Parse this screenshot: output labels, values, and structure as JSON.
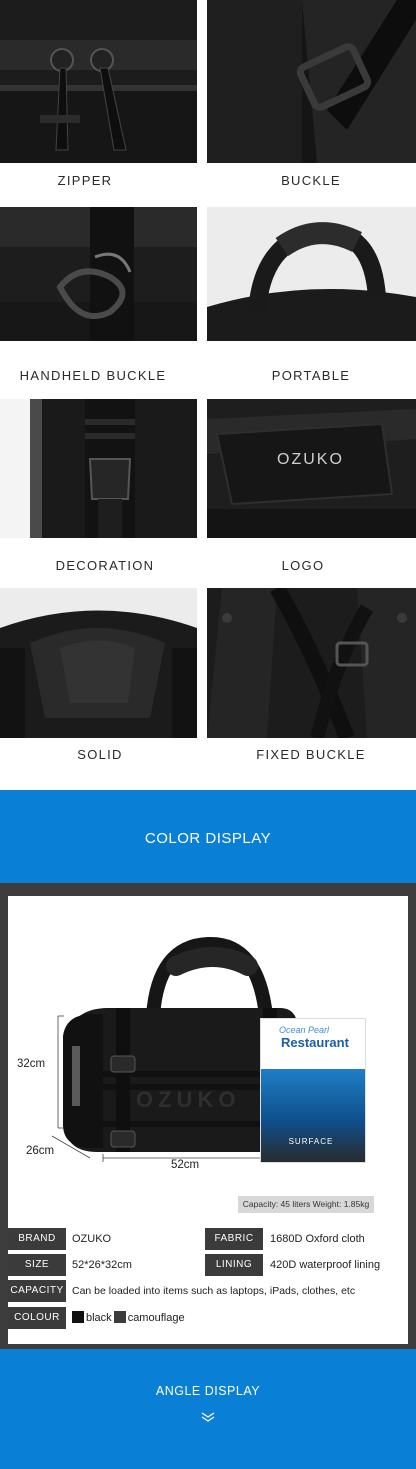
{
  "features": [
    {
      "caption": "ZIPPER",
      "icon": "zipper-pull-icon"
    },
    {
      "caption": "BUCKLE",
      "icon": "strap-buckle-icon"
    },
    {
      "caption": "HANDHELD BUCKLE",
      "icon": "swivel-buckle-icon"
    },
    {
      "caption": "PORTABLE",
      "icon": "handle-icon"
    },
    {
      "caption": "DECORATION",
      "icon": "side-release-buckle-icon"
    },
    {
      "caption": "LOGO",
      "icon": "logo-strap-icon"
    },
    {
      "caption": "SOLID",
      "icon": "open-bag-icon"
    },
    {
      "caption": "FIXED BUCKLE",
      "icon": "back-panel-icon"
    }
  ],
  "color_section": {
    "title": "COLOR DISPLAY",
    "background": "#0a7fd6"
  },
  "product": {
    "logo_text": "OZUKO",
    "strap_logo": "OZUKO",
    "height": "32cm",
    "depth": "26cm",
    "width": "52cm",
    "capacity_note": "Capacity: 45 liters Weight: 1.85kg",
    "magazine_title_1": "Ocean Pearl",
    "magazine_title_2": "Restaurant",
    "magazine_sub": "SURFACE"
  },
  "specs": {
    "brand_label": "BRAND",
    "brand_value": "OZUKO",
    "fabric_label": "FABRIC",
    "fabric_value": "1680D Oxford cloth",
    "size_label": "SIZE",
    "size_value": "52*26*32cm",
    "lining_label": "LINING",
    "lining_value": "420D waterproof lining",
    "capacity_label": "CAPACITY",
    "capacity_value": "Can be loaded into items such as laptops, iPads, clothes, etc",
    "colour_label": "COLOUR",
    "colours": [
      {
        "name": "black",
        "color": "#111111"
      },
      {
        "name": "camouflage",
        "color": "#3c3c3c"
      }
    ]
  },
  "angle_section": {
    "title": "ANGLE DISPLAY",
    "icon": "double-chevron-down-icon"
  }
}
